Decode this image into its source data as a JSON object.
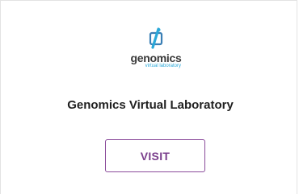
{
  "card": {
    "logo": {
      "wordmark": "genomics",
      "subtitle": "virtual laboratory",
      "icon": "gvl-logo-icon"
    },
    "title": "Genomics Virtual Laboratory",
    "visit_label": "VISIT"
  },
  "colors": {
    "button_border": "#8a4a9a",
    "button_text": "#7a3f8c",
    "logo_accent": "#2aa8d8"
  }
}
